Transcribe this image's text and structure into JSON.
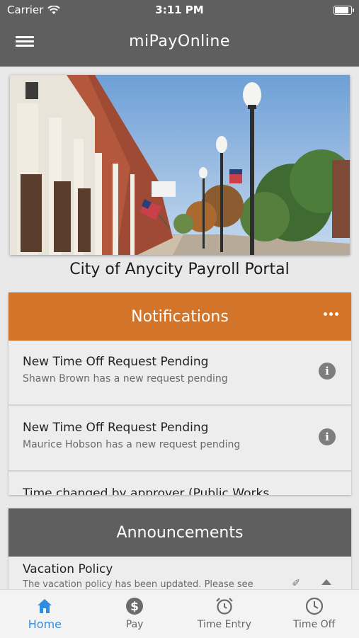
{
  "status_bar": {
    "carrier": "Carrier",
    "time": "3:11 PM",
    "battery_level": 0.95
  },
  "header": {
    "title": "miPayOnline",
    "menu_icon": "hamburger-menu-icon"
  },
  "portal": {
    "title": "City of Anycity Payroll Portal"
  },
  "notifications": {
    "title": "Notifications",
    "items": [
      {
        "title": "New Time Off Request Pending",
        "subtitle": "Shawn Brown has a new request pending"
      },
      {
        "title": "New Time Off Request Pending",
        "subtitle": "Maurice Hobson has a new request pending"
      },
      {
        "title": "Time changed by approver (Public Works",
        "subtitle": ""
      }
    ]
  },
  "announcements": {
    "title": "Announcements",
    "items": [
      {
        "title": "Vacation Policy",
        "subtitle": "The vacation policy has been updated.  Please see"
      }
    ]
  },
  "tabs": [
    {
      "label": "Home",
      "icon": "home-icon",
      "active": true
    },
    {
      "label": "Pay",
      "icon": "dollar-icon",
      "active": false
    },
    {
      "label": "Time Entry",
      "icon": "alarm-clock-icon",
      "active": false
    },
    {
      "label": "Time Off",
      "icon": "clock-icon",
      "active": false
    }
  ],
  "colors": {
    "header": "#5f5f5f",
    "notifications": "#d2742a",
    "active_tab": "#2f8ee0"
  }
}
